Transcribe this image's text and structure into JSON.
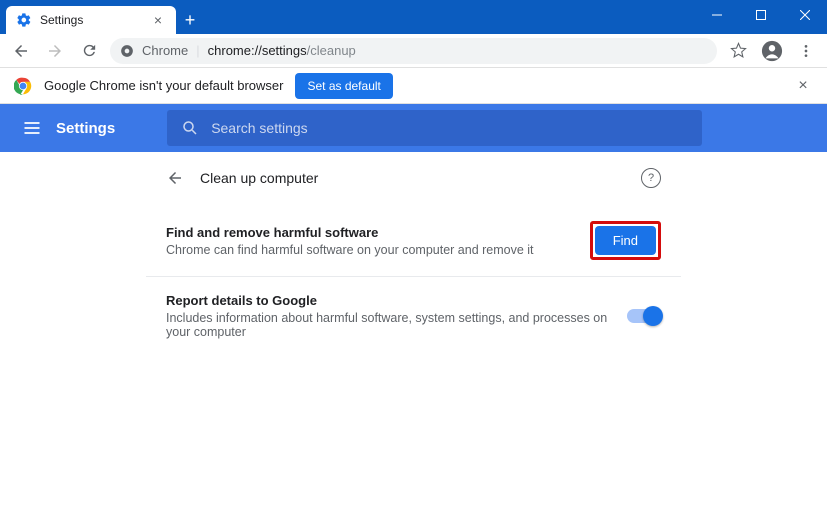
{
  "window": {
    "tab_title": "Settings"
  },
  "omnibox": {
    "scheme_label": "Chrome",
    "url_part1": "chrome://settings",
    "url_part2": "/cleanup"
  },
  "infobar": {
    "text": "Google Chrome isn't your default browser",
    "button": "Set as default"
  },
  "header": {
    "brand": "Settings",
    "search_placeholder": "Search settings"
  },
  "section": {
    "title": "Clean up computer"
  },
  "rows": {
    "find": {
      "title": "Find and remove harmful software",
      "desc": "Chrome can find harmful software on your computer and remove it",
      "button": "Find"
    },
    "report": {
      "title": "Report details to Google",
      "desc": "Includes information about harmful software, system settings, and processes on your computer",
      "toggle_on": true
    }
  }
}
